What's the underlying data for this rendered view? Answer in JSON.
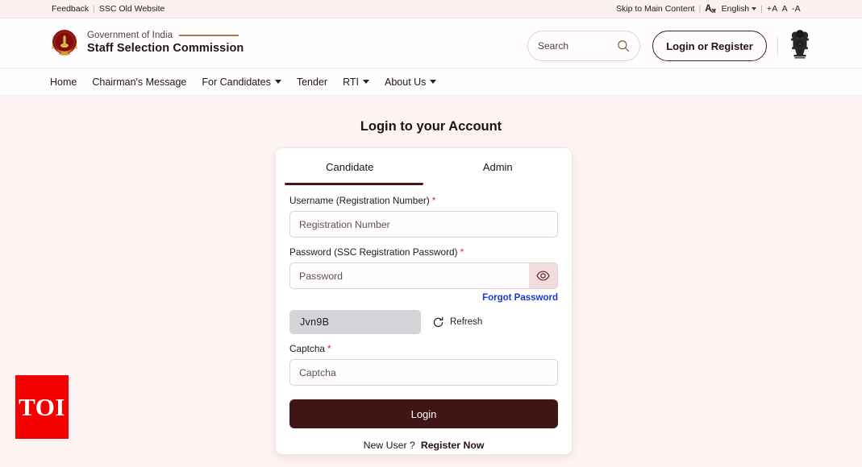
{
  "topbar": {
    "feedback": "Feedback",
    "separator": "|",
    "old_website": "SSC Old Website",
    "skip": "Skip to Main Content",
    "lang_icon_main": "A",
    "lang_icon_sub": "अ",
    "language": "English",
    "font_increase": "+A",
    "font_normal": "A",
    "font_decrease": "-A"
  },
  "header": {
    "gov_line": "Government of India",
    "org_name": "Staff Selection Commission",
    "search_placeholder": "Search",
    "login_register": "Login or Register"
  },
  "nav": {
    "items": [
      {
        "label": "Home",
        "caret": false
      },
      {
        "label": "Chairman's Message",
        "caret": false
      },
      {
        "label": "For Candidates",
        "caret": true
      },
      {
        "label": "Tender",
        "caret": false
      },
      {
        "label": "RTI",
        "caret": true
      },
      {
        "label": "About Us",
        "caret": true
      }
    ]
  },
  "main": {
    "page_title": "Login to your Account",
    "tabs": [
      {
        "label": "Candidate",
        "active": true
      },
      {
        "label": "Admin",
        "active": false
      }
    ],
    "username": {
      "label": "Username (Registration Number)",
      "required_mark": "*",
      "placeholder": "Registration Number",
      "value": ""
    },
    "password": {
      "label": "Password (SSC Registration Password)",
      "required_mark": "*",
      "placeholder": "Password",
      "value": "",
      "forgot_label": "Forgot Password"
    },
    "captcha": {
      "image_text": "Jvn9B",
      "refresh_label": "Refresh",
      "label": "Captcha",
      "required_mark": "*",
      "placeholder": "Captcha",
      "value": ""
    },
    "submit_label": "Login",
    "new_user_text": "New User ?",
    "register_label": "Register Now"
  },
  "watermark": {
    "text": "TOI"
  },
  "colors": {
    "page_bg": "#fdf3f2",
    "accent_maroon": "#3f1515",
    "link_blue": "#1a39d8",
    "required_red": "#e8202a",
    "captcha_bg": "#d5d4d9",
    "watermark_red": "#f50000"
  }
}
